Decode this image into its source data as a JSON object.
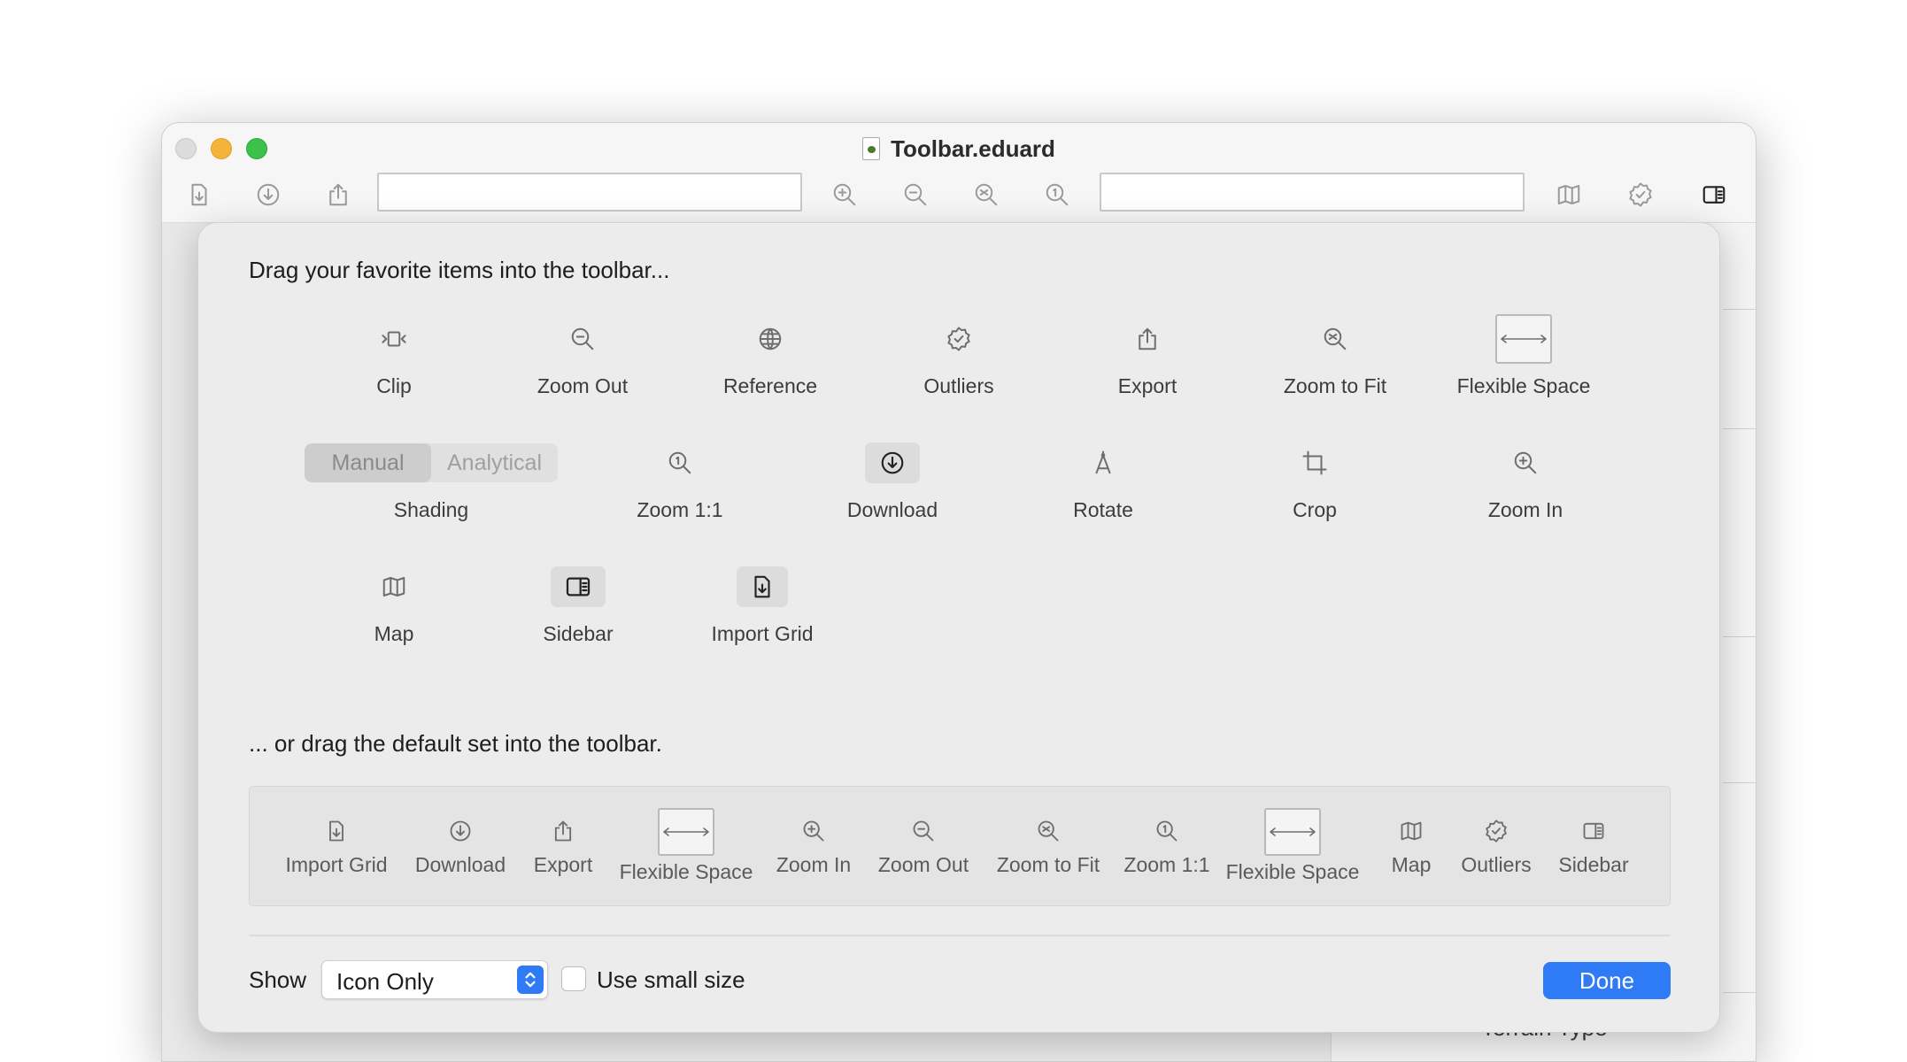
{
  "window": {
    "title": "Toolbar.eduard"
  },
  "toolbar": {
    "items": [
      {
        "name": "Import Grid",
        "icon": "import-grid-icon"
      },
      {
        "name": "Download",
        "icon": "download-icon"
      },
      {
        "name": "Export",
        "icon": "export-icon"
      },
      {
        "name": "Zoom In",
        "icon": "zoom-in-icon"
      },
      {
        "name": "Zoom Out",
        "icon": "zoom-out-icon"
      },
      {
        "name": "Zoom to Fit",
        "icon": "zoom-to-fit-icon"
      },
      {
        "name": "Zoom 1:1",
        "icon": "zoom-1-1-icon"
      },
      {
        "name": "Map",
        "icon": "map-icon"
      },
      {
        "name": "Outliers",
        "icon": "outliers-icon"
      },
      {
        "name": "Sidebar",
        "icon": "sidebar-icon"
      }
    ]
  },
  "sheet": {
    "favorites_heading": "Drag your favorite items into the toolbar...",
    "favorites": {
      "clip": "Clip",
      "zoom_out": "Zoom Out",
      "reference": "Reference",
      "outliers": "Outliers",
      "export": "Export",
      "zoom_to_fit": "Zoom to Fit",
      "flexible_space": "Flexible Space",
      "shading": "Shading",
      "shading_options": [
        "Manual",
        "Analytical"
      ],
      "zoom_1_1": "Zoom 1:1",
      "download": "Download",
      "rotate": "Rotate",
      "crop": "Crop",
      "zoom_in": "Zoom In",
      "map": "Map",
      "sidebar": "Sidebar",
      "import_grid": "Import Grid"
    },
    "default_heading": "... or drag the default set into the toolbar.",
    "default_set": [
      "Import Grid",
      "Download",
      "Export",
      "Flexible Space",
      "Zoom In",
      "Zoom Out",
      "Zoom to Fit",
      "Zoom 1:1",
      "Flexible Space",
      "Map",
      "Outliers",
      "Sidebar"
    ],
    "show_label": "Show",
    "show_value": "Icon Only",
    "small_size_label": "Use small size",
    "small_size_checked": false,
    "done_label": "Done"
  },
  "background": {
    "visible_label": "Terrain Type"
  },
  "colors": {
    "accent": "#2f7bf5",
    "close": "#dcdcdc",
    "minimize": "#f4b43a",
    "maximize": "#3cc14a"
  }
}
